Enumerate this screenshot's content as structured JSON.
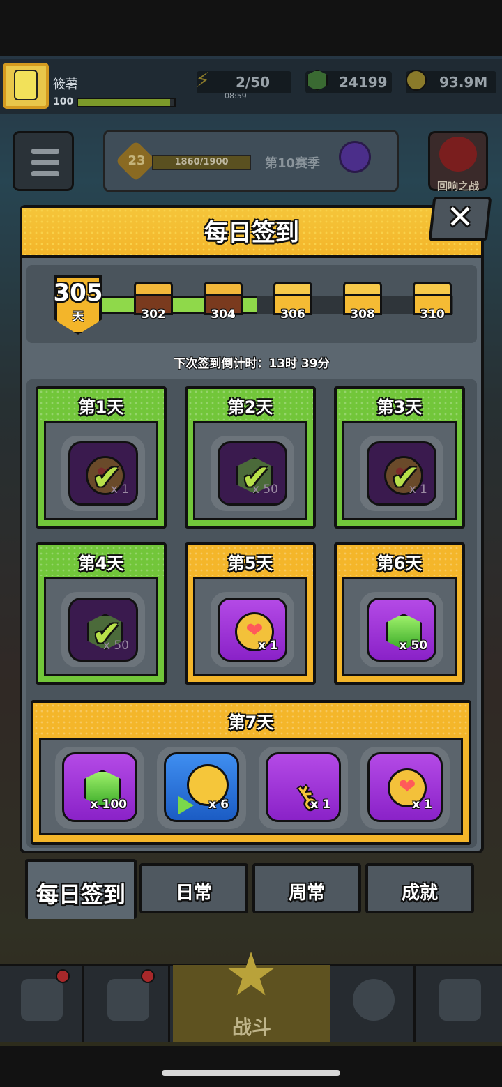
{
  "hud": {
    "player_name": "筱薯",
    "player_level": "100",
    "energy": "2/50",
    "energy_timer": "08:59",
    "gems": "24199",
    "coins": "93.9M"
  },
  "season": {
    "level": "23",
    "progress": "1860/1900",
    "name": "第10赛季"
  },
  "echo_battle": {
    "label": "回响之战"
  },
  "modal": {
    "title": "每日签到",
    "close_icon": "✕",
    "streak_days": "305",
    "streak_unit": "天",
    "milestones": [
      "302",
      "304",
      "306",
      "308",
      "310"
    ],
    "countdown": "下次签到倒计时：13时 39分",
    "days": [
      {
        "label": "第1天",
        "reward": "heart-coin",
        "qty": "x 1",
        "claimed": true
      },
      {
        "label": "第2天",
        "reward": "gem",
        "qty": "x 50",
        "claimed": true
      },
      {
        "label": "第3天",
        "reward": "heart-coin",
        "qty": "x 1",
        "claimed": true
      },
      {
        "label": "第4天",
        "reward": "gem",
        "qty": "x 50",
        "claimed": true
      },
      {
        "label": "第5天",
        "reward": "heart-coin",
        "qty": "x 1",
        "claimed": false
      },
      {
        "label": "第6天",
        "reward": "gem",
        "qty": "x 50",
        "claimed": false
      }
    ],
    "day7": {
      "label": "第7天",
      "rewards": [
        {
          "reward": "gem",
          "qty": "x 100"
        },
        {
          "reward": "coin-ticket",
          "qty": "x 6"
        },
        {
          "reward": "key",
          "qty": "x 1"
        },
        {
          "reward": "heart-coin",
          "qty": "x 1"
        }
      ]
    }
  },
  "tabs": [
    "每日签到",
    "日常",
    "周常",
    "成就"
  ],
  "bottom_nav": {
    "battle": "战斗"
  },
  "colors": {
    "claimed": "#72c63a",
    "pending": "#f4b62a",
    "panel": "#5c6770"
  }
}
